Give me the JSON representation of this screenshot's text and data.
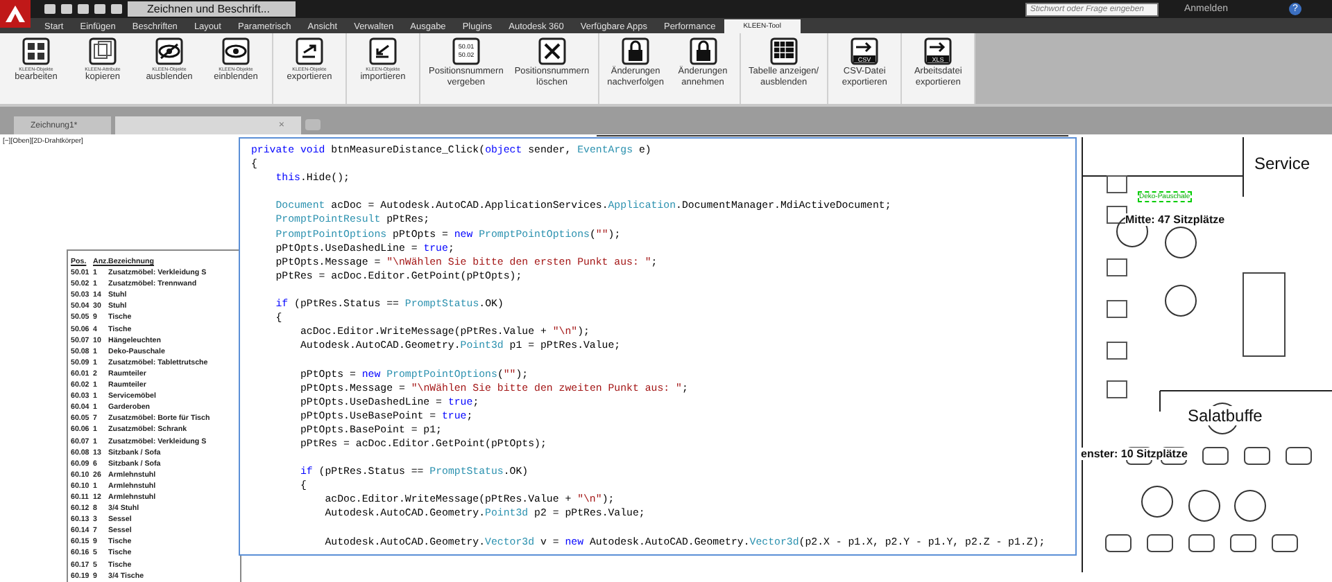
{
  "title_bar": {
    "workspace": "Zeichnen und Beschrift...",
    "search": {
      "placeholder": "Stichwort oder Frage eingeben"
    },
    "sign_in": "Anmelden",
    "help": "?"
  },
  "ribbon_tabs": [
    {
      "label": "Start",
      "selected": false
    },
    {
      "label": "Einfügen",
      "selected": false
    },
    {
      "label": "Beschriften",
      "selected": false
    },
    {
      "label": "Layout",
      "selected": false
    },
    {
      "label": "Parametrisch",
      "selected": false
    },
    {
      "label": "Ansicht",
      "selected": false
    },
    {
      "label": "Verwalten",
      "selected": false
    },
    {
      "label": "Ausgabe",
      "selected": false
    },
    {
      "label": "Plugins",
      "selected": false
    },
    {
      "label": "Autodesk 360",
      "selected": false
    },
    {
      "label": "Verfügbare Apps",
      "selected": false
    },
    {
      "label": "Performance",
      "selected": false
    },
    {
      "label": "KLEEN-Tool",
      "selected": true
    }
  ],
  "ribbon_panels": [
    {
      "buttons": [
        {
          "kind": "grid",
          "header": "KLEEN-Objekte",
          "lines": [
            "bearbeiten"
          ]
        },
        {
          "kind": "copy",
          "header": "KLEEN-Attribute",
          "lines": [
            "kopieren"
          ]
        },
        {
          "kind": "eye-off",
          "header": "KLEEN-Objekte",
          "lines": [
            "ausblenden"
          ]
        },
        {
          "kind": "eye",
          "header": "KLEEN-Objekte",
          "lines": [
            "einblenden"
          ]
        }
      ]
    },
    {
      "buttons": [
        {
          "kind": "export",
          "header": "KLEEN-Objekte",
          "lines": [
            "exportieren"
          ]
        }
      ]
    },
    {
      "buttons": [
        {
          "kind": "import",
          "header": "KLEEN-Objekte",
          "lines": [
            "importieren"
          ]
        }
      ]
    },
    {
      "buttons": [
        {
          "kind": "numbers",
          "icon_text": [
            "50.01",
            "50.02"
          ],
          "lines": [
            "Positionsnummern",
            "vergeben"
          ]
        },
        {
          "kind": "cross",
          "lines": [
            "Positionsnummern",
            "löschen"
          ]
        }
      ]
    },
    {
      "buttons": [
        {
          "kind": "lock",
          "lines": [
            "Änderungen",
            "nachverfolgen"
          ]
        },
        {
          "kind": "lock",
          "lines": [
            "Änderungen",
            "annehmen"
          ]
        }
      ]
    },
    {
      "buttons": [
        {
          "kind": "table",
          "lines": [
            "Tabelle anzeigen/",
            "ausblenden"
          ]
        }
      ]
    },
    {
      "buttons": [
        {
          "kind": "file-arrow",
          "icon_text": [
            "CSV"
          ],
          "lines": [
            "CSV-Datei",
            "exportieren"
          ]
        }
      ]
    },
    {
      "buttons": [
        {
          "kind": "file-arrow",
          "icon_text": [
            "XLS"
          ],
          "lines": [
            "Arbeitsdatei",
            "exportieren"
          ]
        }
      ]
    }
  ],
  "doc_tabs": [
    {
      "label": "Zeichnung1*",
      "selected": false
    },
    {
      "selected": true,
      "close": "×"
    }
  ],
  "viewport_label": "[−][Oben][2D-Drahtkörper]",
  "table": {
    "columns": [
      "Pos.",
      "Anz.",
      "Bezeichnung"
    ],
    "rows": [
      [
        "50.01",
        "1",
        "Zusatzmöbel: Verkleidung S"
      ],
      [
        "50.02",
        "1",
        "Zusatzmöbel: Trennwand"
      ],
      [
        "50.03",
        "14",
        "Stuhl"
      ],
      [
        "50.04",
        "30",
        "Stuhl"
      ],
      [
        "50.05",
        "9",
        "Tische"
      ],
      [
        "50.06",
        "4",
        "Tische"
      ],
      [
        "50.07",
        "10",
        "Hängeleuchten"
      ],
      [
        "50.08",
        "1",
        "Deko-Pauschale"
      ],
      [
        "50.09",
        "1",
        "Zusatzmöbel: Tablettrutsche"
      ],
      [
        "60.01",
        "2",
        "Raumteiler"
      ],
      [
        "60.02",
        "1",
        "Raumteiler"
      ],
      [
        "60.03",
        "1",
        "Servicemöbel"
      ],
      [
        "60.04",
        "1",
        "Garderoben"
      ],
      [
        "60.05",
        "7",
        "Zusatzmöbel: Borte für Tisch"
      ],
      [
        "60.06",
        "1",
        "Zusatzmöbel: Schrank"
      ],
      [
        "60.07",
        "1",
        "Zusatzmöbel: Verkleidung S"
      ],
      [
        "60.08",
        "13",
        "Sitzbank / Sofa"
      ],
      [
        "60.09",
        "6",
        "Sitzbank / Sofa"
      ],
      [
        "60.10",
        "26",
        "Armlehnstuhl"
      ],
      [
        "60.10",
        "1",
        "Armlehnstuhl"
      ],
      [
        "60.11",
        "12",
        "Armlehnstuhl"
      ],
      [
        "60.12",
        "8",
        "3/4 Stuhl"
      ],
      [
        "60.13",
        "3",
        "Sessel"
      ],
      [
        "60.14",
        "7",
        "Sessel"
      ],
      [
        "60.15",
        "9",
        "Tische"
      ],
      [
        "60.16",
        "5",
        "Tische"
      ],
      [
        "60.17",
        "5",
        "Tische"
      ],
      [
        "60.19",
        "9",
        "3/4 Tische"
      ]
    ]
  },
  "plan": {
    "labels": [
      {
        "text": "Service",
        "kind": "title"
      },
      {
        "text": "Deko-Pauschale",
        "kind": "note"
      },
      {
        "text": "Mitte: 47 Sitzplätze",
        "kind": "heading"
      },
      {
        "text": "Salatbuffe",
        "kind": "title"
      },
      {
        "text": "enster: 10 Sitzplätze",
        "kind": "heading"
      }
    ]
  },
  "code": [
    {
      "blank_before": false,
      "spans": [
        {
          "text": "private void",
          "kind": "kw"
        },
        {
          "text": " btnMeasureDistance_Click(",
          "kind": "plain"
        },
        {
          "text": "object",
          "kind": "kw"
        },
        {
          "text": " sender, ",
          "kind": "plain"
        },
        {
          "text": "EventArgs",
          "kind": "type"
        },
        {
          "text": " e)",
          "kind": "plain"
        }
      ]
    },
    {
      "blank_before": false,
      "spans": [
        {
          "text": "{",
          "kind": "plain"
        }
      ]
    },
    {
      "blank_before": false,
      "spans": [
        {
          "text": "    this",
          "kind": "kw"
        },
        {
          "text": ".Hide();",
          "kind": "plain"
        }
      ]
    },
    {
      "blank_before": true,
      "spans": [
        {
          "text": "    Document",
          "kind": "type"
        },
        {
          "text": " acDoc = Autodesk.AutoCAD.ApplicationServices.",
          "kind": "plain"
        },
        {
          "text": "Application",
          "kind": "type"
        },
        {
          "text": ".DocumentManager.MdiActiveDocument;",
          "kind": "plain"
        }
      ]
    },
    {
      "blank_before": false,
      "spans": [
        {
          "text": "    PromptPointResult",
          "kind": "type"
        },
        {
          "text": " pPtRes;",
          "kind": "plain"
        }
      ]
    },
    {
      "blank_before": false,
      "spans": [
        {
          "text": "    PromptPointOptions",
          "kind": "type"
        },
        {
          "text": " pPtOpts = ",
          "kind": "plain"
        },
        {
          "text": "new ",
          "kind": "kw"
        },
        {
          "text": "PromptPointOptions",
          "kind": "type"
        },
        {
          "text": "(",
          "kind": "plain"
        },
        {
          "text": "\"\"",
          "kind": "str"
        },
        {
          "text": ");",
          "kind": "plain"
        }
      ]
    },
    {
      "blank_before": false,
      "spans": [
        {
          "text": "    pPtOpts.UseDashedLine = ",
          "kind": "plain"
        },
        {
          "text": "true",
          "kind": "kw"
        },
        {
          "text": ";",
          "kind": "plain"
        }
      ]
    },
    {
      "blank_before": false,
      "spans": [
        {
          "text": "    pPtOpts.Message = ",
          "kind": "plain"
        },
        {
          "text": "\"\\nWählen Sie bitte den ersten Punkt aus: \"",
          "kind": "str"
        },
        {
          "text": ";",
          "kind": "plain"
        }
      ]
    },
    {
      "blank_before": false,
      "spans": [
        {
          "text": "    pPtRes = acDoc.Editor.GetPoint(pPtOpts);",
          "kind": "plain"
        }
      ]
    },
    {
      "blank_before": true,
      "spans": [
        {
          "text": "    if",
          "kind": "kw"
        },
        {
          "text": " (pPtRes.Status == ",
          "kind": "plain"
        },
        {
          "text": "PromptStatus",
          "kind": "type"
        },
        {
          "text": ".OK)",
          "kind": "plain"
        }
      ]
    },
    {
      "blank_before": false,
      "spans": [
        {
          "text": "    {",
          "kind": "plain"
        }
      ]
    },
    {
      "blank_before": false,
      "spans": [
        {
          "text": "        acDoc.Editor.WriteMessage(pPtRes.Value + ",
          "kind": "plain"
        },
        {
          "text": "\"\\n\"",
          "kind": "str"
        },
        {
          "text": ");",
          "kind": "plain"
        }
      ]
    },
    {
      "blank_before": false,
      "spans": [
        {
          "text": "        Autodesk.AutoCAD.Geometry.",
          "kind": "plain"
        },
        {
          "text": "Point3d",
          "kind": "type"
        },
        {
          "text": " p1 = pPtRes.Value;",
          "kind": "plain"
        }
      ]
    },
    {
      "blank_before": true,
      "spans": [
        {
          "text": "        pPtOpts = ",
          "kind": "plain"
        },
        {
          "text": "new ",
          "kind": "kw"
        },
        {
          "text": "PromptPointOptions",
          "kind": "type"
        },
        {
          "text": "(",
          "kind": "plain"
        },
        {
          "text": "\"\"",
          "kind": "str"
        },
        {
          "text": ");",
          "kind": "plain"
        }
      ]
    },
    {
      "blank_before": false,
      "spans": [
        {
          "text": "        pPtOpts.Message = ",
          "kind": "plain"
        },
        {
          "text": "\"\\nWählen Sie bitte den zweiten Punkt aus: \"",
          "kind": "str"
        },
        {
          "text": ";",
          "kind": "plain"
        }
      ]
    },
    {
      "blank_before": false,
      "spans": [
        {
          "text": "        pPtOpts.UseDashedLine = ",
          "kind": "plain"
        },
        {
          "text": "true",
          "kind": "kw"
        },
        {
          "text": ";",
          "kind": "plain"
        }
      ]
    },
    {
      "blank_before": false,
      "spans": [
        {
          "text": "        pPtOpts.UseBasePoint = ",
          "kind": "plain"
        },
        {
          "text": "true",
          "kind": "kw"
        },
        {
          "text": ";",
          "kind": "plain"
        }
      ]
    },
    {
      "blank_before": false,
      "spans": [
        {
          "text": "        pPtOpts.BasePoint = p1;",
          "kind": "plain"
        }
      ]
    },
    {
      "blank_before": false,
      "spans": [
        {
          "text": "        pPtRes = acDoc.Editor.GetPoint(pPtOpts);",
          "kind": "plain"
        }
      ]
    },
    {
      "blank_before": true,
      "spans": [
        {
          "text": "        if",
          "kind": "kw"
        },
        {
          "text": " (pPtRes.Status == ",
          "kind": "plain"
        },
        {
          "text": "PromptStatus",
          "kind": "type"
        },
        {
          "text": ".OK)",
          "kind": "plain"
        }
      ]
    },
    {
      "blank_before": false,
      "spans": [
        {
          "text": "        {",
          "kind": "plain"
        }
      ]
    },
    {
      "blank_before": false,
      "spans": [
        {
          "text": "            acDoc.Editor.WriteMessage(pPtRes.Value + ",
          "kind": "plain"
        },
        {
          "text": "\"\\n\"",
          "kind": "str"
        },
        {
          "text": ");",
          "kind": "plain"
        }
      ]
    },
    {
      "blank_before": false,
      "spans": [
        {
          "text": "            Autodesk.AutoCAD.Geometry.",
          "kind": "plain"
        },
        {
          "text": "Point3d",
          "kind": "type"
        },
        {
          "text": " p2 = pPtRes.Value;",
          "kind": "plain"
        }
      ]
    },
    {
      "blank_before": true,
      "spans": [
        {
          "text": "            Autodesk.AutoCAD.Geometry.",
          "kind": "plain"
        },
        {
          "text": "Vector3d",
          "kind": "type"
        },
        {
          "text": " v = ",
          "kind": "plain"
        },
        {
          "text": "new",
          "kind": "kw"
        },
        {
          "text": " Autodesk.AutoCAD.Geometry.",
          "kind": "plain"
        },
        {
          "text": "Vector3d",
          "kind": "type"
        },
        {
          "text": "(p2.X - p1.X, p2.Y - p1.Y, p2.Z - p1.Z);",
          "kind": "plain"
        }
      ]
    }
  ]
}
